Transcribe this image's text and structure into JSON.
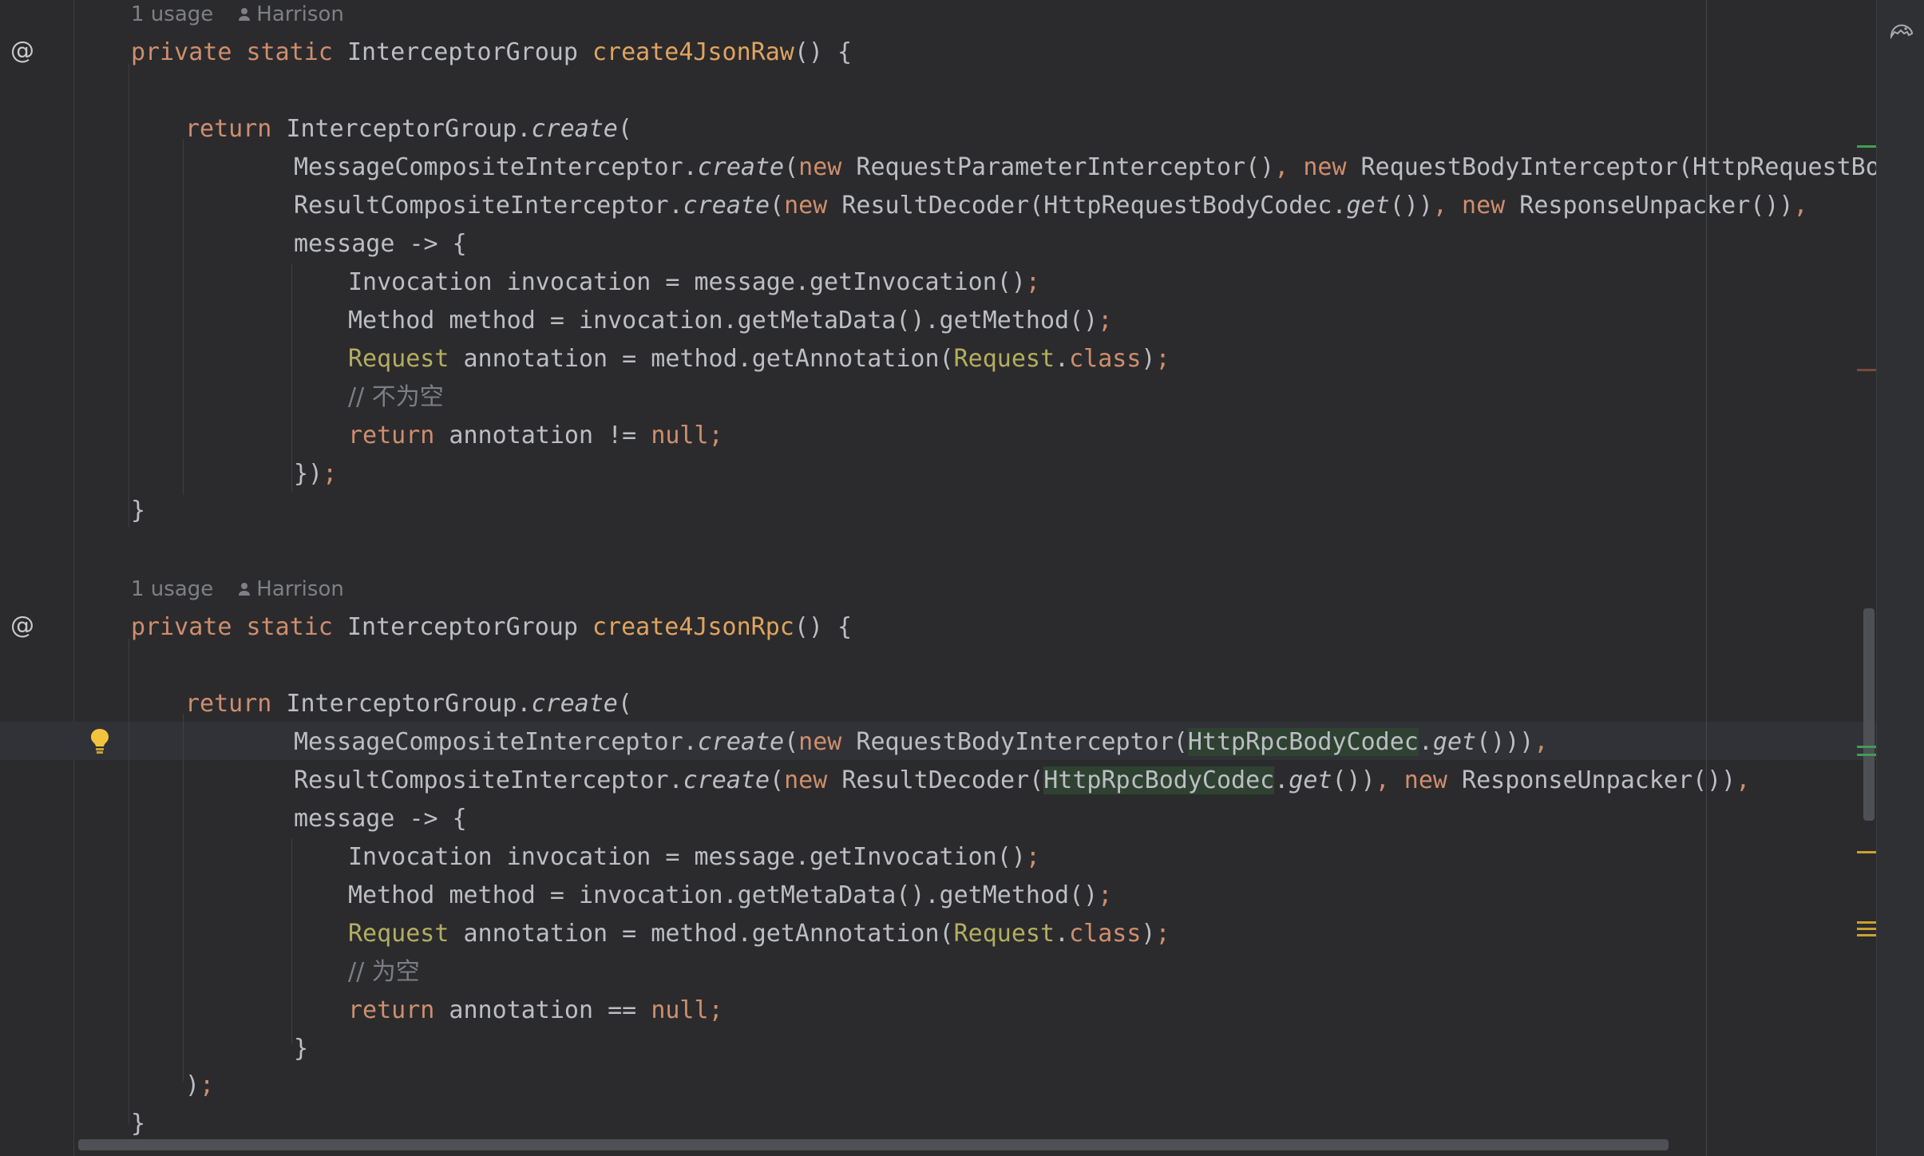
{
  "usage_hints": [
    {
      "usages": "1 usage",
      "author": "Harrison"
    },
    {
      "usages": "1 usage",
      "author": "Harrison"
    }
  ],
  "code": {
    "m1_sig": {
      "mod1": "private",
      "mod2": "static",
      "type": "InterceptorGroup",
      "name": "create4JsonRaw",
      "tail": "() {"
    },
    "m1_ret": {
      "kw": "return",
      "cls": "InterceptorGroup.",
      "call": "create",
      "paren": "("
    },
    "m1_a1": {
      "cls": "MessageCompositeInterceptor.",
      "call": "create",
      "p1": "(",
      "n1": "new",
      "c1": " RequestParameterInterceptor()",
      "comma": ",",
      "n2": "new",
      "c2": " RequestBodyInterceptor(HttpRequestBodyCodec"
    },
    "m1_a2": {
      "cls": "ResultCompositeInterceptor.",
      "call": "create",
      "p1": "(",
      "n1": "new",
      "c1": " ResultDecoder(HttpRequestBodyCodec.",
      "get": "get",
      "c1b": "())",
      "comma": ",",
      "n2": "new",
      "c2": " ResponseUnpacker())",
      "comma2": ","
    },
    "m1_lambda": "message -> {",
    "m1_l1": {
      "text": "Invocation invocation = message.getInvocation()",
      "semi": ";"
    },
    "m1_l2": {
      "text": "Method method = invocation.getMetaData().getMethod()",
      "semi": ";"
    },
    "m1_l3": {
      "an1": "Request",
      "t1": " annotation = method.getAnnotation(",
      "an2": "Request",
      "dot": ".",
      "kw": "class",
      "t2": ")",
      "semi": ";"
    },
    "m1_comment": "// 不为空",
    "m1_l5": {
      "kw": "return",
      "t": " annotation != ",
      "null": "null",
      "semi": ";"
    },
    "m1_close_lambda": "})",
    "m1_close_lambda_semi": ";",
    "m1_close": "}",
    "m2_sig": {
      "mod1": "private",
      "mod2": "static",
      "type": "InterceptorGroup",
      "name": "create4JsonRpc",
      "tail": "() {"
    },
    "m2_ret": {
      "kw": "return",
      "cls": "InterceptorGroup.",
      "call": "create",
      "paren": "("
    },
    "m2_a1": {
      "cls": "MessageCompositeInterceptor.",
      "call": "create",
      "p1": "(",
      "n1": "new",
      "c1": " RequestBodyInterceptor(",
      "hl": "HttpRpcBodyCodec",
      "dot": ".",
      "get": "get",
      "c1b": "()))",
      "comma": ","
    },
    "m2_a2": {
      "cls": "ResultCompositeInterceptor.",
      "call": "create",
      "p1": "(",
      "n1": "new",
      "c1": " ResultDecoder(",
      "hl": "HttpRpcBodyCodec",
      "dot": ".",
      "get": "get",
      "c1b": "())",
      "comma": ",",
      "n2": "new",
      "c2": " ResponseUnpacker())",
      "comma2": ","
    },
    "m2_lambda": "message -> {",
    "m2_l1": {
      "text": "Invocation invocation = message.getInvocation()",
      "semi": ";"
    },
    "m2_l2": {
      "text": "Method method = invocation.getMetaData().getMethod()",
      "semi": ";"
    },
    "m2_l3": {
      "an1": "Request",
      "t1": " annotation = method.getAnnotation(",
      "an2": "Request",
      "dot": ".",
      "kw": "class",
      "t2": ")",
      "semi": ";"
    },
    "m2_comment": "// 为空",
    "m2_l5": {
      "kw": "return",
      "t": " annotation == ",
      "null": "null",
      "semi": ";"
    },
    "m2_close_lambda": "}",
    "m2_close_paren": ")",
    "m2_close_paren_semi": ";",
    "m2_close": "}"
  },
  "colors": {
    "keyword": "#cf8e6d",
    "method_decl": "#e0a45f",
    "annotation": "#b3ae60",
    "comment": "#7a7e85",
    "plain": "#bcbec4",
    "background": "#2b2b2d"
  },
  "icons": [
    "at-override-icon",
    "lightbulb-icon",
    "ai-assistant-icon"
  ]
}
